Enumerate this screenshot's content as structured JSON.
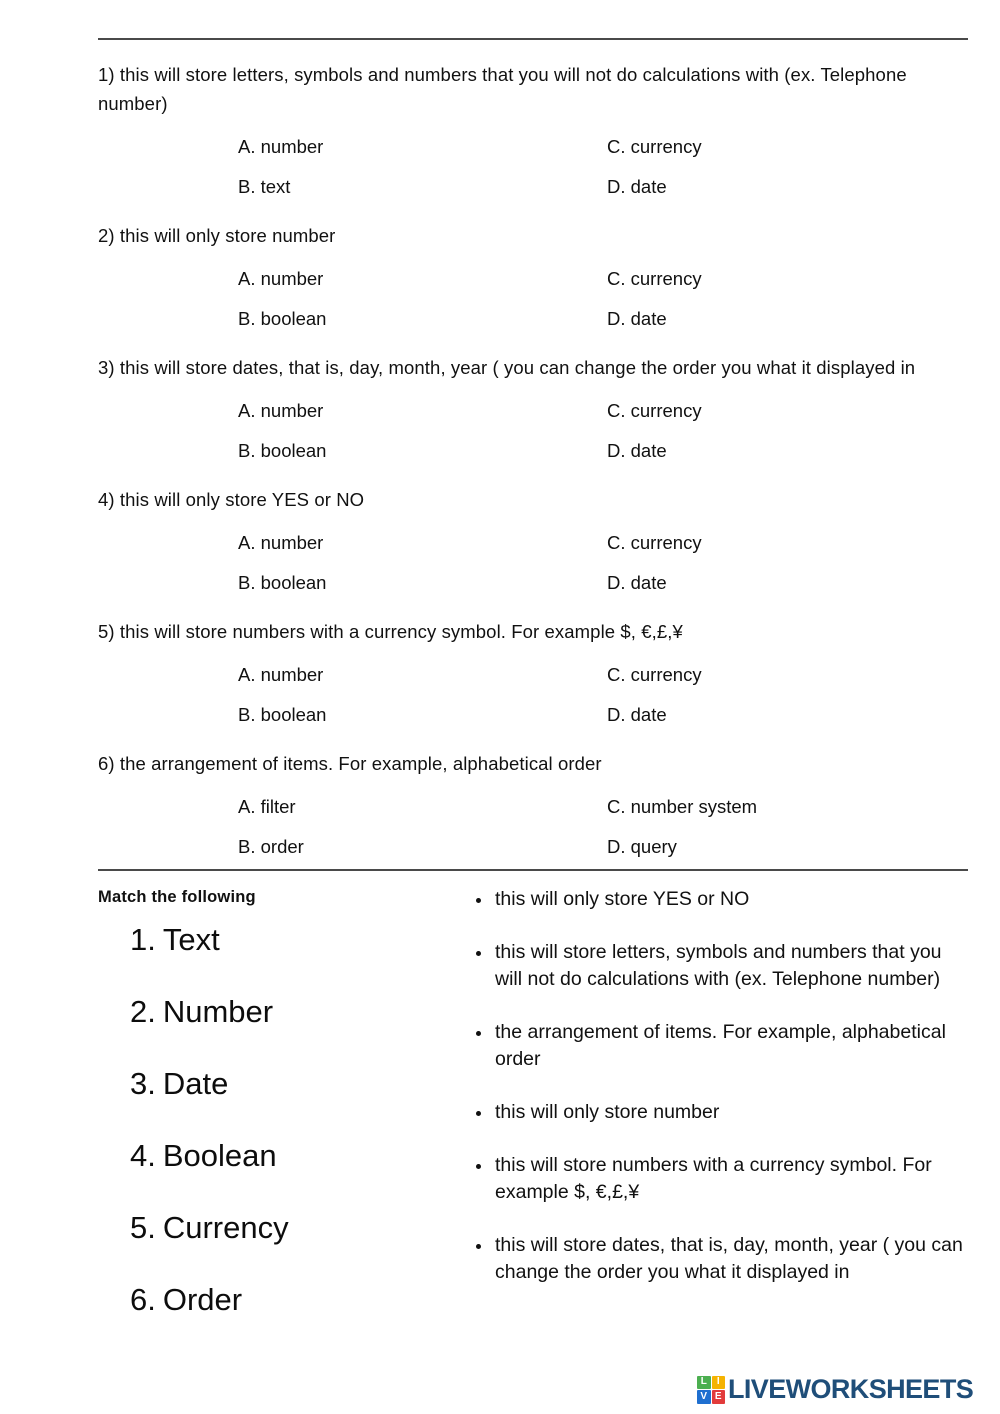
{
  "worksheet": {
    "dividers": [
      "top-rule",
      "mid-rule"
    ],
    "mcq": {
      "questions": [
        {
          "number": "1)",
          "prompt": "this will store letters, symbols and numbers that you will not do calculations with (ex. Telephone number)",
          "option_a": "A. number",
          "option_b": "B. text",
          "option_c": "C. currency",
          "option_d": "D. date"
        },
        {
          "number": "2)",
          "prompt": "this will only store number",
          "option_a": "A. number",
          "option_b": "B. boolean",
          "option_c": "C. currency",
          "option_d": "D. date"
        },
        {
          "number": "3)",
          "prompt": "this will store dates, that is, day, month, year ( you can change the order you what it displayed in",
          "option_a": "A. number",
          "option_b": "B. boolean",
          "option_c": "C. currency",
          "option_d": "D. date"
        },
        {
          "number": "4)",
          "prompt": "this will only store YES or NO",
          "option_a": "A. number",
          "option_b": "B. boolean",
          "option_c": "C. currency",
          "option_d": "D. date"
        },
        {
          "number": "5)",
          "prompt": "this will store numbers with a currency symbol. For example $, €,£,¥",
          "option_a": "A. number",
          "option_b": "B. boolean",
          "option_c": "C. currency",
          "option_d": "D. date"
        },
        {
          "number": "6)",
          "prompt": "the arrangement of items. For example, alphabetical order",
          "option_a": "A. filter",
          "option_b": "B. order",
          "option_c": "C. number system",
          "option_d": "D. query"
        }
      ],
      "q1_full": "1) this will store letters, symbols and numbers that you will not do calculations with (ex. Telephone number)",
      "q2_full": "2) this will only store number",
      "q3_full": "3) this will store dates, that is, day, month, year ( you can change the order you what it displayed in",
      "q4_full": "4)  this will only store YES or NO",
      "q5_full": "5)  this will store numbers with a currency symbol. For example $, €,£,¥",
      "q6_full": "6)  the arrangement of items. For example, alphabetical order"
    },
    "match": {
      "title": "Match the following",
      "terms": [
        {
          "number": "1.",
          "label": "Text"
        },
        {
          "number": "2.",
          "label": "Number"
        },
        {
          "number": "3.",
          "label": "Date"
        },
        {
          "number": "4.",
          "label": "Boolean"
        },
        {
          "number": "5.",
          "label": "Currency"
        },
        {
          "number": "6.",
          "label": "Order"
        }
      ],
      "definitions": [
        "this will only store YES or NO",
        "this will store letters, symbols and numbers that you will not do calculations with (ex. Telephone number)",
        "the arrangement of items. For example, alphabetical order",
        "this will only store number",
        "this will store numbers with a currency symbol. For example $, €,£,¥",
        "this will store dates, that is, day, month, year ( you can change the order you what it displayed in"
      ]
    },
    "footer": {
      "brand_text": "LIVEWORKSHEETS",
      "brand_color": "#1f4e79",
      "logo_tiles": [
        {
          "letter": "L",
          "color": "#4caf50"
        },
        {
          "letter": "I",
          "color": "#f5b301"
        },
        {
          "letter": "V",
          "color": "#1f6fd0"
        },
        {
          "letter": "E",
          "color": "#e23b3b"
        }
      ]
    }
  }
}
